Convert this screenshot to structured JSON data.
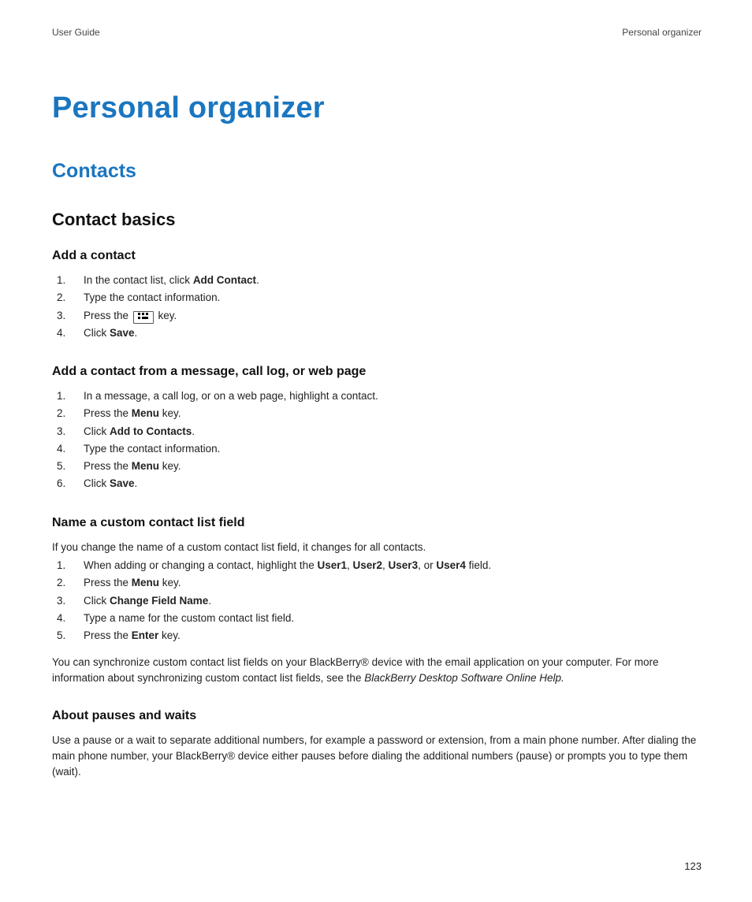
{
  "header": {
    "left": "User Guide",
    "right": "Personal organizer"
  },
  "title": "Personal organizer",
  "section_title": "Contacts",
  "subsection_title": "Contact basics",
  "blocks": [
    {
      "heading": "Add a contact",
      "steps": [
        {
          "pre": "In the contact list, click ",
          "bold": "Add Contact",
          "post": "."
        },
        {
          "pre": "Type the contact information."
        },
        {
          "pre": "Press the ",
          "icon": "bb-menu",
          "post": " key."
        },
        {
          "pre": "Click ",
          "bold": "Save",
          "post": "."
        }
      ]
    },
    {
      "heading": "Add a contact from a message, call log, or web page",
      "steps": [
        {
          "pre": "In a message, a call log, or on a web page, highlight a contact."
        },
        {
          "pre": "Press the ",
          "bold": "Menu",
          "post": " key."
        },
        {
          "pre": "Click ",
          "bold": "Add to Contacts",
          "post": "."
        },
        {
          "pre": "Type the contact information."
        },
        {
          "pre": "Press the ",
          "bold": "Menu",
          "post": " key."
        },
        {
          "pre": "Click ",
          "bold": "Save",
          "post": "."
        }
      ]
    },
    {
      "heading": "Name a custom contact list field",
      "intro": "If you change the name of a custom contact list field, it changes for all contacts.",
      "steps": [
        {
          "pre": "When adding or changing a contact, highlight the ",
          "bold": "User1",
          "mid1": ", ",
          "bold2": "User2",
          "mid2": ", ",
          "bold3": "User3",
          "mid3": ", or ",
          "bold4": "User4",
          "post": " field."
        },
        {
          "pre": "Press the ",
          "bold": "Menu",
          "post": " key."
        },
        {
          "pre": "Click ",
          "bold": "Change Field Name",
          "post": "."
        },
        {
          "pre": "Type a name for the custom contact list field."
        },
        {
          "pre": "Press the ",
          "bold": "Enter",
          "post": " key."
        }
      ],
      "after_pre": "You can synchronize custom contact list fields on your BlackBerry® device with the email application on your computer. For more information about synchronizing custom contact list fields, see the  ",
      "after_italic": "BlackBerry Desktop Software Online Help."
    },
    {
      "heading": "About pauses and waits",
      "paragraph": "Use a pause or a wait to separate additional numbers, for example a password or extension, from a main phone number. After dialing the main phone number, your BlackBerry® device either pauses before dialing the additional numbers (pause) or prompts you to type them (wait)."
    }
  ],
  "page_number": "123"
}
